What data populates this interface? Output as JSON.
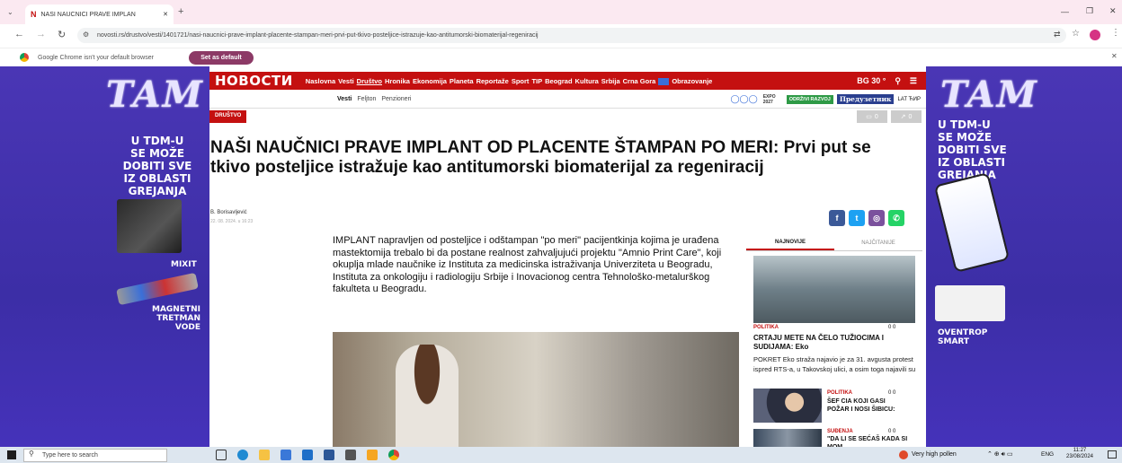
{
  "browser": {
    "tab_title": "NAŠI NAUČNICI PRAVE IMPLAN",
    "url": "novosti.rs/drustvo/vesti/1401721/nasi-naucnici-prave-implant-placente-stampan-meri-prvi-put-tkivo-posteljice-istrazuje-kao-antitumorski-biomaterijal-regeniracij",
    "infobar_text": "Google Chrome isn't your default browser",
    "set_default": "Set as default"
  },
  "ad_left": {
    "logo": "TAM",
    "headline": [
      "U TDM-U",
      "SE MOŽE",
      "DOBITI SVE",
      "IZ OBLASTI",
      "GREJANJA"
    ],
    "product1": "MIXIT",
    "product2": [
      "MAGNETNI",
      "TRETMAN VODE"
    ]
  },
  "ad_right": {
    "logo": "TAM",
    "headline": [
      "U TDM-U",
      "SE MOŽE",
      "DOBITI SVE",
      "IZ OBLASTI",
      "GREJANJA"
    ],
    "product": [
      "OVENTROP",
      "SMART"
    ]
  },
  "site": {
    "logo": "НОВОСТИ",
    "nav": [
      "Naslovna",
      "Vesti",
      "Društvo",
      "Hronika",
      "Ekonomija",
      "Planeta",
      "Reportaže",
      "Sport",
      "TIP",
      "Beograd",
      "Kultura",
      "Srbija",
      "Crna Gora"
    ],
    "nav_extra": "Obrazovanje",
    "weather": "BG 30 °",
    "subnav": [
      "Vesti",
      "Feljton",
      "Penzioneri"
    ],
    "badge1": "ODRŽIVI RAZVOJ",
    "badge2": "Предузетник",
    "lang": "LAT ЋИР",
    "expo": "EXPO 2027"
  },
  "article": {
    "section": "DRUŠTVO",
    "title": "NAŠI NAUČNICI PRAVE IMPLANT OD PLACENTE ŠTAMPAN PO MERI: Prvi put se tkivo posteljice istražuje kao antitumorski biomaterijal za regeniracij",
    "author": "B. Borisavljević",
    "date": "22. 08. 2024. u 16:23",
    "comments": "0",
    "shares": "0",
    "lead": "IMPLANT napravljen od posteljice i odštampan \"po meri\" pacijentkinja kojima je urađena mastektomija trebalo bi da postane realnost zahvaljujući projektu \"Amnio Print Care\", koji okuplja mlade naučnike iz Instituta za medicinska istraživanja Univerziteta u Beogradu, Instituta za onkologiju i radiologiju Srbije i Inovacionog centra Tehnološko-metalurškog fakulteta u Beogradu."
  },
  "sidebar": {
    "tabs": [
      "NAJNOVIJE",
      "NAJČITANIJE"
    ],
    "stories": [
      {
        "category": "POLITIKA",
        "counts": "0 0",
        "title": "CRTAJU METE NA ČELO TUŽIOCIMA I SUDIJAMA: Eko",
        "excerpt": "POKRET Eko straža najavio je za 31. avgusta protest ispred RTS-a, u Takovskoj ulici, a osim toga najavili su"
      },
      {
        "category": "POLITIKA",
        "counts": "0 0",
        "title": "ŠEF CIA KOJI GASI POŽAR I NOSI ŠIBICU:"
      },
      {
        "category": "SUĐENJA",
        "counts": "0 0",
        "title": "\"DA LI SE SEĆAŠ KADA SI MOM"
      }
    ]
  },
  "taskbar": {
    "search": "Type here to search",
    "weather": "Very high pollen",
    "lang": "ENG",
    "time": "11:27",
    "date": "23/08/2024"
  }
}
